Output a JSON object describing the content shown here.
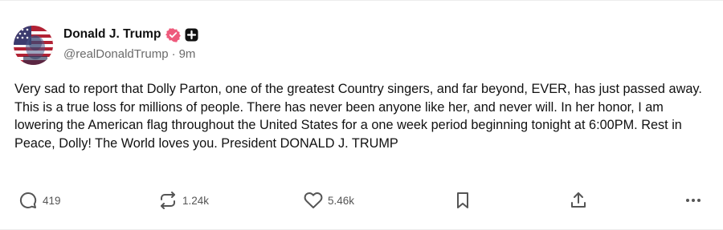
{
  "post": {
    "author": {
      "display_name": "Donald J. Trump",
      "handle": "@realDonaldTrump",
      "verified": true
    },
    "separator": "·",
    "time_ago": "9m",
    "body": "Very sad to report that Dolly Parton, one of the greatest Country singers, and far beyond, EVER, has just passed away. This is a true loss for millions of people. There has never been anyone like her, and never will. In her honor, I am lowering the American flag throughout the United States for a one week period beginning tonight at 6:00PM. Rest in Peace, Dolly! The World loves you. President DONALD J. TRUMP"
  },
  "actions": {
    "replies": {
      "icon": "reply-icon",
      "count": "419"
    },
    "reposts": {
      "icon": "repost-icon",
      "count": "1.24k"
    },
    "likes": {
      "icon": "heart-icon",
      "count": "5.46k"
    },
    "bookmark": {
      "icon": "bookmark-icon"
    },
    "share": {
      "icon": "share-icon"
    },
    "more": {
      "icon": "more-icon"
    }
  },
  "colors": {
    "verified_badge": "#ee5a7c",
    "icon_gray": "#555555",
    "handle_gray": "#6b6b6b",
    "text": "#111111"
  }
}
